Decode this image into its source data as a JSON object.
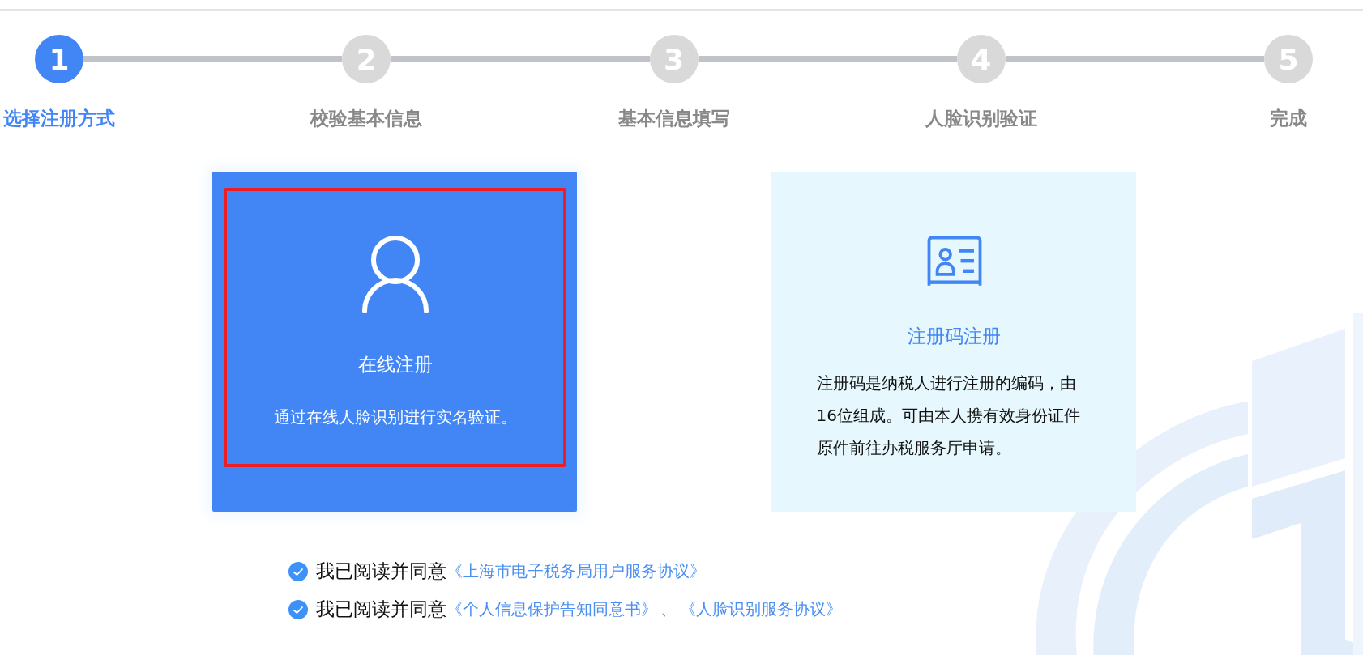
{
  "steps": [
    {
      "number": "1",
      "label": "选择注册方式",
      "current": true
    },
    {
      "number": "2",
      "label": "校验基本信息",
      "current": false
    },
    {
      "number": "3",
      "label": "基本信息填写",
      "current": false
    },
    {
      "number": "4",
      "label": "人脸识别验证",
      "current": false
    },
    {
      "number": "5",
      "label": "完成",
      "current": false
    }
  ],
  "options": [
    {
      "kind": "online",
      "title": "在线注册",
      "description": "通过在线人脸识别进行实名验证。",
      "selected": true,
      "highlighted": true
    },
    {
      "kind": "code",
      "title": "注册码注册",
      "description": "注册码是纳税人进行注册的编码，由16位组成。可由本人携有效身份证件原件前往办税服务厅申请。",
      "selected": false,
      "highlighted": false
    }
  ],
  "agreements": [
    {
      "checked": true,
      "label": "我已阅读并同意",
      "links": [
        "《上海市电子税务局用户服务协议》"
      ]
    },
    {
      "checked": true,
      "label": "我已阅读并同意",
      "links": [
        "《个人信息保护告知同意书》",
        "《人脸识别服务协议》"
      ],
      "separator": "、"
    }
  ]
}
